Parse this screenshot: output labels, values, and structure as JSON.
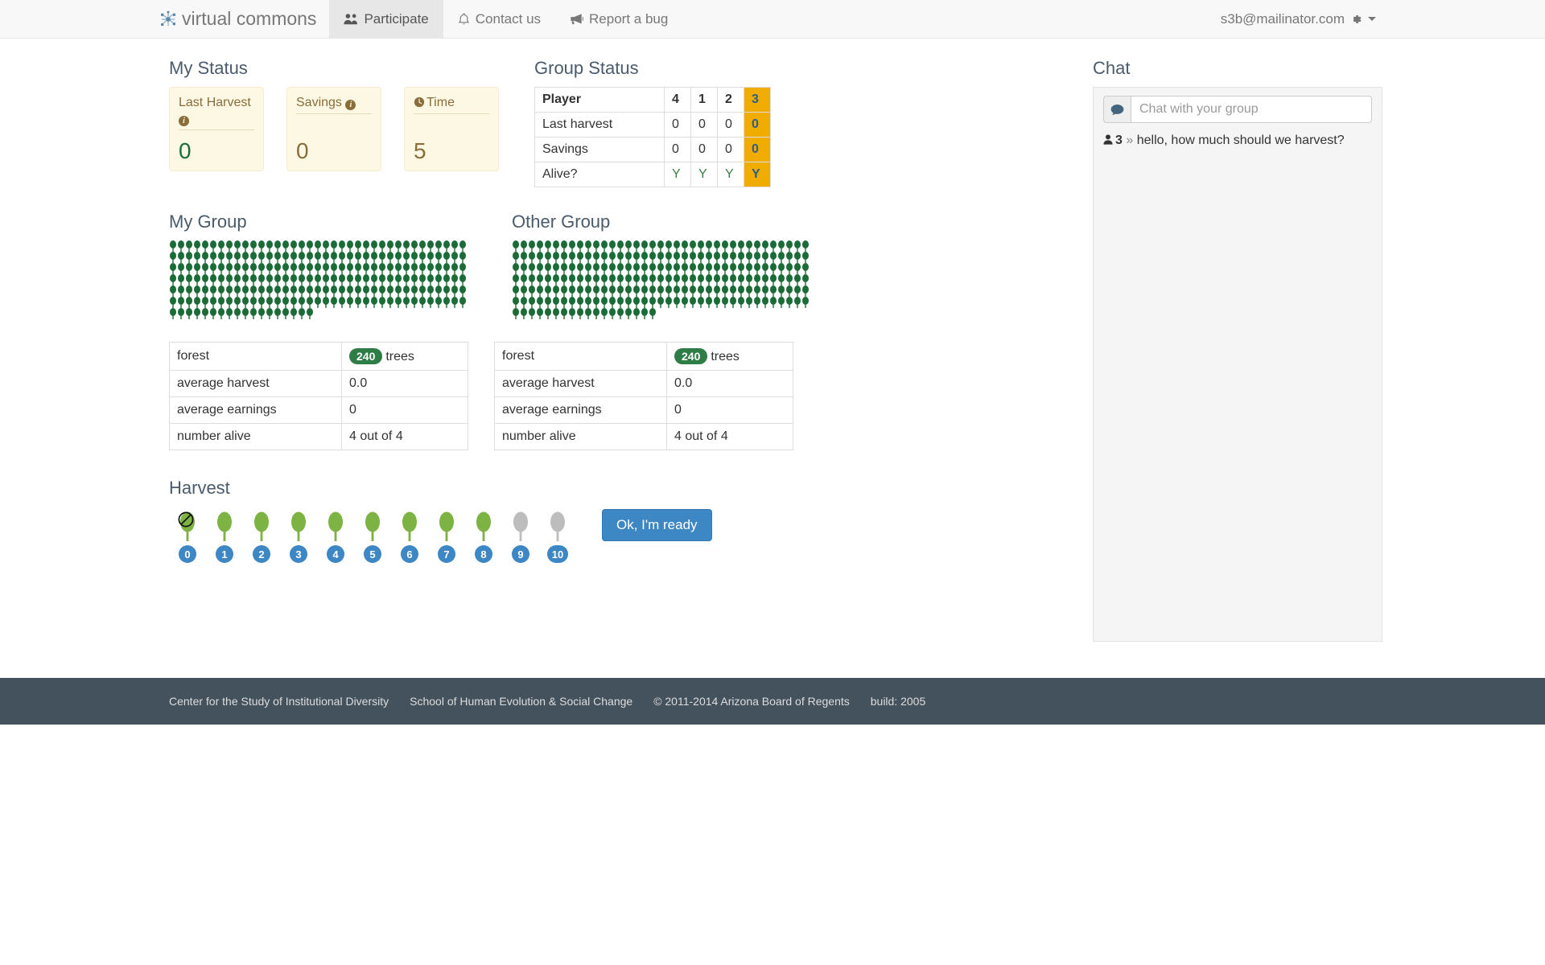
{
  "navbar": {
    "brand": "virtual commons",
    "brand_icon": "network-nodes-icon",
    "links": [
      {
        "label": "Participate",
        "icon": "users-icon",
        "active": true
      },
      {
        "label": "Contact us",
        "icon": "bell-icon",
        "active": false
      },
      {
        "label": "Report a bug",
        "icon": "bullhorn-icon",
        "active": false
      }
    ],
    "user": "s3b@mailinator.com",
    "user_icon": "gear-icon"
  },
  "my_status": {
    "title": "My Status",
    "cards": [
      {
        "label": "Last Harvest",
        "value": "0",
        "has_info": true,
        "info_icon": "info-circle-icon",
        "value_color": "#1b6b37"
      },
      {
        "label": "Savings",
        "value": "0",
        "has_info": true,
        "info_icon": "info-circle-icon",
        "value_color": "#8a6d3b"
      },
      {
        "label": "Time",
        "value": "5",
        "has_clock": true,
        "clock_icon": "clock-icon",
        "value_color": "#8a6d3b"
      }
    ]
  },
  "group_status": {
    "title": "Group Status",
    "header": [
      "Player",
      "4",
      "1",
      "2",
      "3"
    ],
    "highlight_column_index": 4,
    "rows": [
      {
        "label": "Last harvest",
        "values": [
          "0",
          "0",
          "0",
          "0"
        ]
      },
      {
        "label": "Savings",
        "values": [
          "0",
          "0",
          "0",
          "0"
        ]
      },
      {
        "label": "Alive?",
        "values": [
          "Y",
          "Y",
          "Y",
          "Y"
        ]
      }
    ],
    "highlight_color": "#f0ad00"
  },
  "chat": {
    "title": "Chat",
    "icon": "chat-bubble-icon",
    "placeholder": "Chat with your group",
    "value": "",
    "messages": [
      {
        "user_icon": "user-icon",
        "who": "3",
        "arrow": "»",
        "text": "hello, how much should we harvest?"
      }
    ]
  },
  "forests": [
    {
      "title": "My Group",
      "tree_count": 240,
      "tree_color": "#1b6b37",
      "table": {
        "rows": [
          {
            "key": "forest",
            "badge": "240",
            "value": "trees"
          },
          {
            "key": "average harvest",
            "value": "0.0"
          },
          {
            "key": "average earnings",
            "value": "0"
          },
          {
            "key": "number alive",
            "value": "4 out of 4"
          }
        ]
      }
    },
    {
      "title": "Other Group",
      "tree_count": 240,
      "tree_color": "#1b6b37",
      "table": {
        "rows": [
          {
            "key": "forest",
            "badge": "240",
            "value": "trees"
          },
          {
            "key": "average harvest",
            "value": "0.0"
          },
          {
            "key": "average earnings",
            "value": "0"
          },
          {
            "key": "number alive",
            "value": "4 out of 4"
          }
        ]
      }
    }
  ],
  "harvest": {
    "title": "Harvest",
    "selected": "0",
    "options": [
      {
        "label": "0",
        "state": "none",
        "icon": "tree-disabled-icon"
      },
      {
        "label": "1",
        "state": "available",
        "icon": "tree-icon"
      },
      {
        "label": "2",
        "state": "available",
        "icon": "tree-icon"
      },
      {
        "label": "3",
        "state": "available",
        "icon": "tree-icon"
      },
      {
        "label": "4",
        "state": "available",
        "icon": "tree-icon"
      },
      {
        "label": "5",
        "state": "available",
        "icon": "tree-icon"
      },
      {
        "label": "6",
        "state": "available",
        "icon": "tree-icon"
      },
      {
        "label": "7",
        "state": "available",
        "icon": "tree-icon"
      },
      {
        "label": "8",
        "state": "available",
        "icon": "tree-icon"
      },
      {
        "label": "9",
        "state": "disabled",
        "icon": "tree-gray-icon"
      },
      {
        "label": "10",
        "state": "disabled",
        "icon": "tree-gray-icon"
      }
    ],
    "ready_button": "Ok, I'm ready",
    "colors": {
      "available": "#7cb342",
      "disabled": "#bdbdbd",
      "badge": "#3c87c4"
    }
  },
  "footer": {
    "items": [
      "Center for the Study of Institutional Diversity",
      "School of Human Evolution & Social Change",
      "© 2011-2014 Arizona Board of Regents",
      "build: 2005"
    ]
  }
}
